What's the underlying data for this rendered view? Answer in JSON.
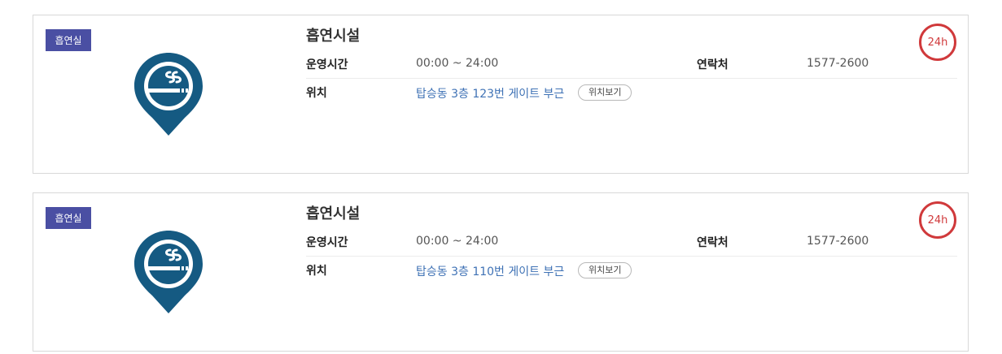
{
  "colors": {
    "badge_bg": "#4a4fa3",
    "pin": "#155a82",
    "hours_ring": "#d0393b",
    "link": "#3f72b5"
  },
  "cards": [
    {
      "badge": "흡연실",
      "icon": "smoking-area-pin-icon",
      "title": "흡연시설",
      "hours_label": "운영시간",
      "hours_value": "00:00 ~ 24:00",
      "contact_label": "연락처",
      "contact_value": "1577-2600",
      "location_label": "위치",
      "location_value": "탑승동 3층 123번 게이트 부근",
      "view_button": "위치보기",
      "hours_badge": "24h"
    },
    {
      "badge": "흡연실",
      "icon": "smoking-area-pin-icon",
      "title": "흡연시설",
      "hours_label": "운영시간",
      "hours_value": "00:00 ~ 24:00",
      "contact_label": "연락처",
      "contact_value": "1577-2600",
      "location_label": "위치",
      "location_value": "탑승동 3층 110번 게이트 부근",
      "view_button": "위치보기",
      "hours_badge": "24h"
    }
  ]
}
